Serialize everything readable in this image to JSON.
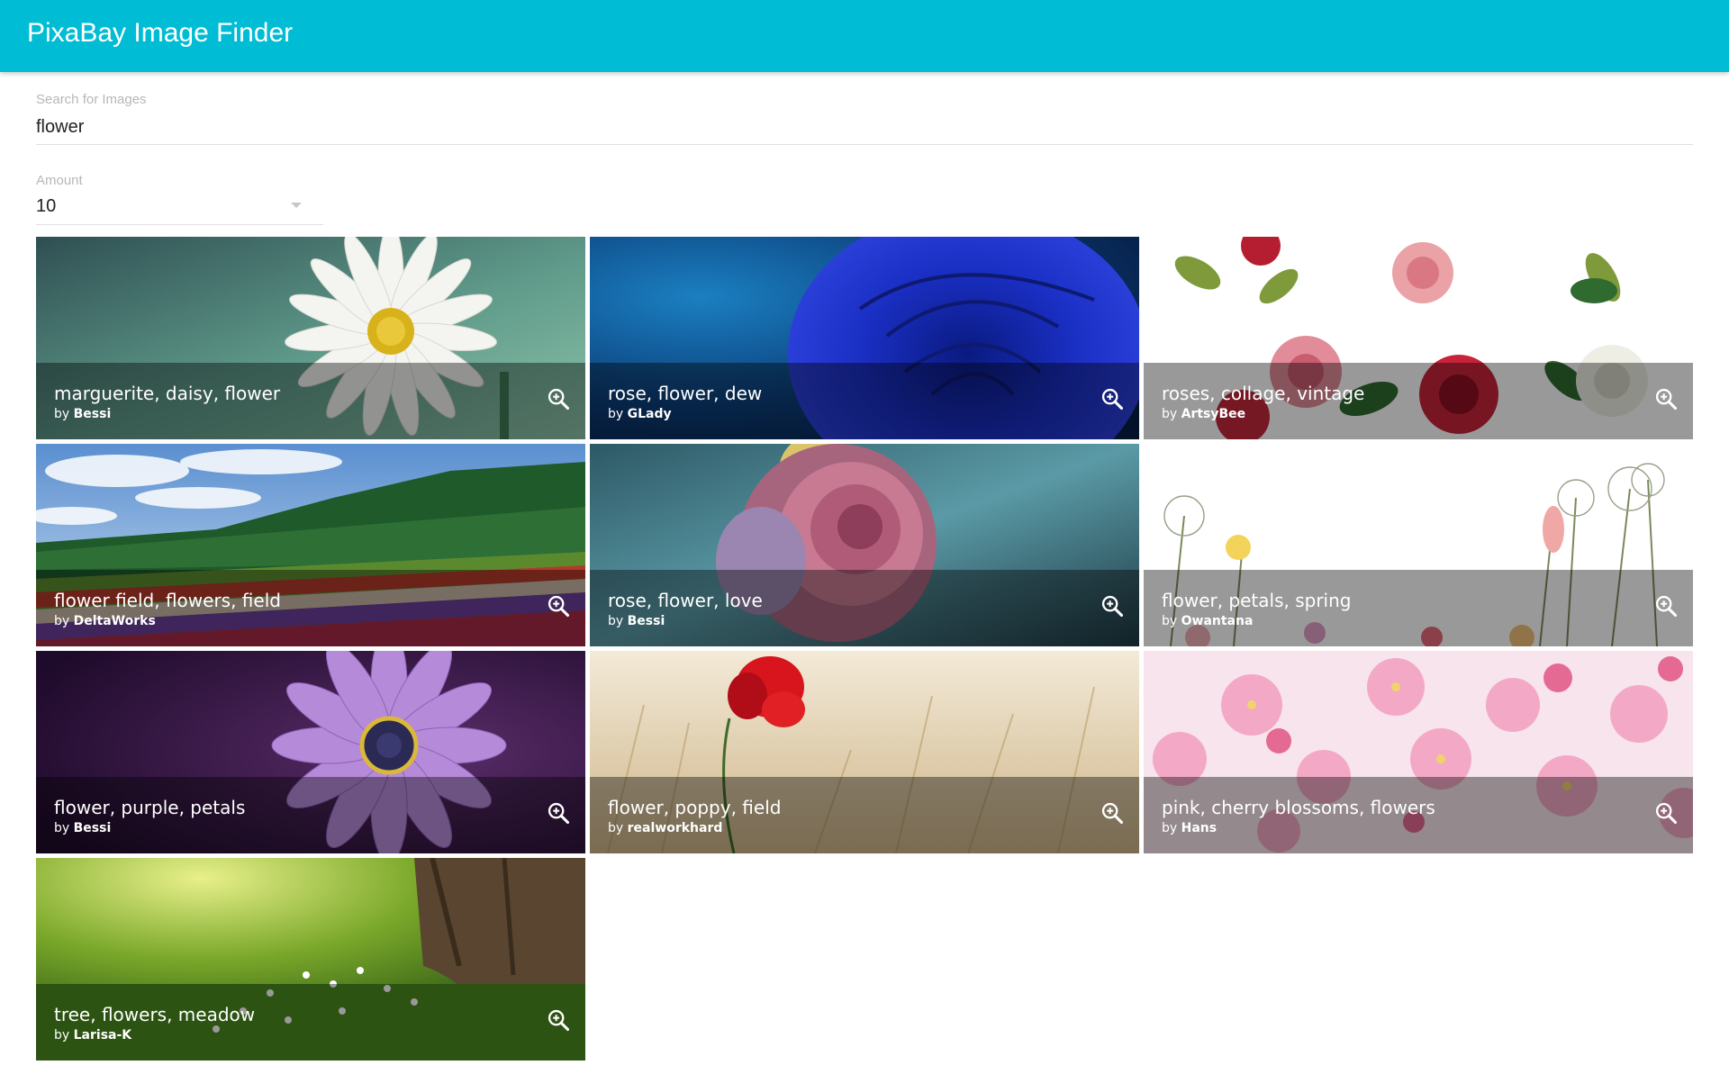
{
  "app": {
    "title": "PixaBay Image Finder",
    "accent": "#00bcd4"
  },
  "search": {
    "label": "Search for Images",
    "value": "flower"
  },
  "amount": {
    "label": "Amount",
    "value": "10"
  },
  "results": [
    {
      "tags": "marguerite, daisy, flower",
      "by": "by",
      "author": "Bessi",
      "icon": "zoom-in-icon"
    },
    {
      "tags": "rose, flower, dew",
      "by": "by",
      "author": "GLady",
      "icon": "zoom-in-icon"
    },
    {
      "tags": "roses, collage, vintage",
      "by": "by",
      "author": "ArtsyBee",
      "icon": "zoom-in-icon"
    },
    {
      "tags": "flower field, flowers, field",
      "by": "by",
      "author": "DeltaWorks",
      "icon": "zoom-in-icon"
    },
    {
      "tags": "rose, flower, love",
      "by": "by",
      "author": "Bessi",
      "icon": "zoom-in-icon"
    },
    {
      "tags": "flower, petals, spring",
      "by": "by",
      "author": "Owantana",
      "icon": "zoom-in-icon"
    },
    {
      "tags": "flower, purple, petals",
      "by": "by",
      "author": "Bessi",
      "icon": "zoom-in-icon"
    },
    {
      "tags": "flower, poppy, field",
      "by": "by",
      "author": "realworkhard",
      "icon": "zoom-in-icon"
    },
    {
      "tags": "pink, cherry blossoms, flowers",
      "by": "by",
      "author": "Hans",
      "icon": "zoom-in-icon"
    },
    {
      "tags": "tree, flowers, meadow",
      "by": "by",
      "author": "Larisa-K",
      "icon": "zoom-in-icon"
    }
  ]
}
